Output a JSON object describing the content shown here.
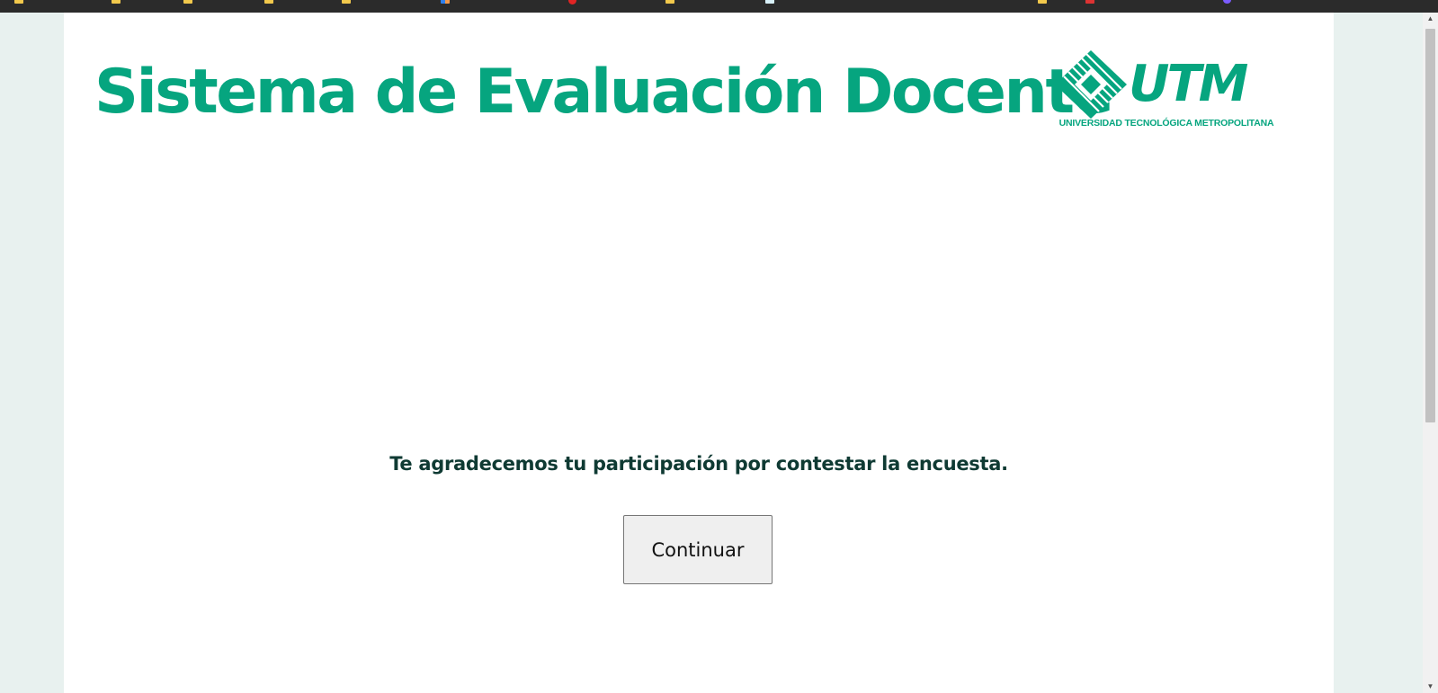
{
  "header": {
    "title": "Sistema de Evaluación Docente",
    "logo_text": "UTM",
    "logo_caption": "UNIVERSIDAD TECNOLÓGICA METROPOLITANA"
  },
  "main": {
    "message": "Te agradecemos tu participación por contestar la encuesta.",
    "continue_label": "Continuar"
  },
  "colors": {
    "brand": "#06a57f",
    "text_dark": "#0f3a33",
    "page_bg": "#e8f1ef"
  },
  "icons": {
    "scroll_up": "triangle-up-icon",
    "scroll_down": "triangle-down-icon",
    "logo": "utm-logo-icon"
  }
}
